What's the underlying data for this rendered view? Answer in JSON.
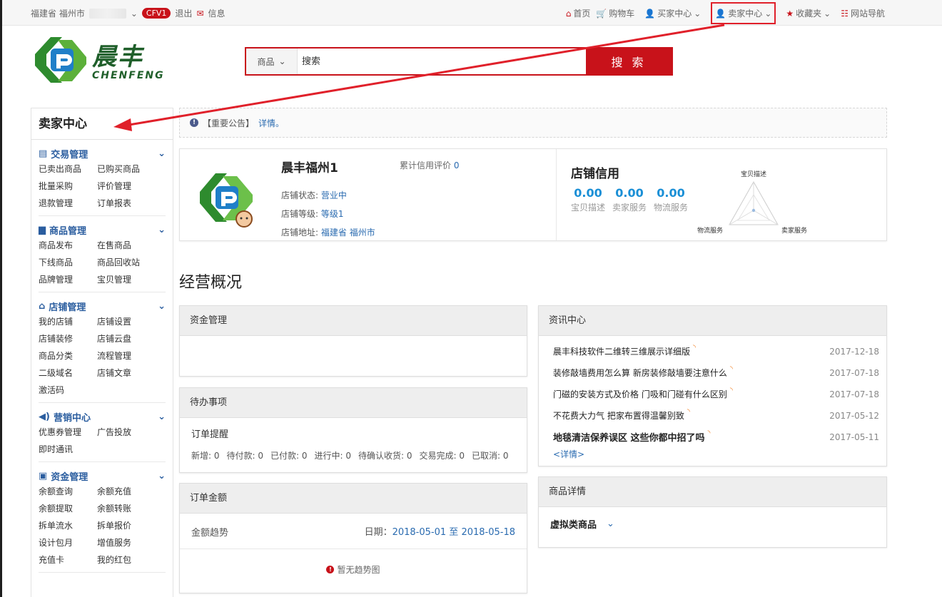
{
  "topbar": {
    "location": "福建省 福州市",
    "badge": "CFV1",
    "logout": "退出",
    "messages": "信息",
    "home": "首页",
    "cart": "购物车",
    "buyer_center": "买家中心",
    "seller_center": "卖家中心",
    "favorites": "收藏夹",
    "site_nav": "网站导航"
  },
  "logo": {
    "cn": "晨丰",
    "en": "CHENFENG"
  },
  "search": {
    "category": "商品",
    "placeholder": "搜索",
    "button": "搜 索"
  },
  "sidebar": {
    "title": "卖家中心",
    "sections": [
      {
        "title": "交易管理",
        "icon": "list-icon",
        "items": [
          "已卖出商品",
          "已购买商品",
          "批量采购",
          "评价管理",
          "退款管理",
          "订单报表"
        ]
      },
      {
        "title": "商品管理",
        "icon": "briefcase-icon",
        "items": [
          "商品发布",
          "在售商品",
          "下线商品",
          "商品回收站",
          "品牌管理",
          "宝贝管理"
        ]
      },
      {
        "title": "店铺管理",
        "icon": "home-icon",
        "items": [
          "我的店铺",
          "店铺设置",
          "店铺装修",
          "店铺云盘",
          "商品分类",
          "流程管理",
          "二级域名",
          "店铺文章",
          "激活码"
        ]
      },
      {
        "title": "营销中心",
        "icon": "megaphone-icon",
        "items": [
          "优惠券管理",
          "广告投放",
          "即时通讯"
        ]
      },
      {
        "title": "资金管理",
        "icon": "money-icon",
        "items": [
          "余额查询",
          "余额充值",
          "余额提取",
          "余额转账",
          "拆单流水",
          "拆单报价",
          "设计包月",
          "增值服务",
          "充值卡",
          "我的红包"
        ]
      }
    ]
  },
  "notice": {
    "label": "【重要公告】",
    "link": "详情。"
  },
  "shop": {
    "name": "晨丰福州1",
    "credit_rating_label": "累计信用评价",
    "credit_rating_value": "0",
    "status_label": "店铺状态:",
    "status_value": "营业中",
    "level_label": "店铺等级:",
    "level_value": "等级1",
    "address_label": "店铺地址:",
    "address_value": "福建省 福州市"
  },
  "credit": {
    "title": "店铺信用",
    "scores": [
      {
        "value": "0.00",
        "label": "宝贝描述"
      },
      {
        "value": "0.00",
        "label": "卖家服务"
      },
      {
        "value": "0.00",
        "label": "物流服务"
      }
    ],
    "radar_labels": {
      "top": "宝贝描述",
      "left": "物流服务",
      "right": "卖家服务"
    }
  },
  "overview": {
    "title": "经营概况"
  },
  "funds": {
    "title": "资金管理"
  },
  "todo": {
    "title": "待办事项",
    "sub": "订单提醒",
    "stats": [
      "新增: 0",
      "待付款: 0",
      "已付款: 0",
      "进行中: 0",
      "待确认收货: 0",
      "交易完成: 0",
      "已取消: 0"
    ]
  },
  "order_amount": {
    "title": "订单金额",
    "trend": "金额趋势",
    "date_label": "日期：",
    "date_from": "2018-05-01",
    "date_to_label": "至",
    "date_to": "2018-05-18",
    "empty": "暂无趋势图"
  },
  "news": {
    "title": "资讯中心",
    "items": [
      {
        "title": "晨丰科技软件二维转三维展示详细版",
        "date": "2017-12-18",
        "bold": false
      },
      {
        "title": "装修敲墙费用怎么算 新房装修敲墙要注意什么",
        "date": "2017-07-18",
        "bold": false
      },
      {
        "title": "门磁的安装方式及价格 门吸和门碰有什么区别",
        "date": "2017-07-18",
        "bold": false
      },
      {
        "title": "不花费大力气 把家布置得温馨别致",
        "date": "2017-05-12",
        "bold": false
      },
      {
        "title": "地毯清洁保养误区 这些你都中招了吗",
        "date": "2017-05-11",
        "bold": true
      }
    ],
    "more": "<详情>"
  },
  "goods": {
    "title": "商品详情",
    "selected": "虚拟类商品"
  },
  "colors": {
    "brand_red": "#c8121a",
    "link_blue": "#2a6bb0",
    "score_blue": "#1a8fd6",
    "logo_green": "#1f5f2a"
  }
}
